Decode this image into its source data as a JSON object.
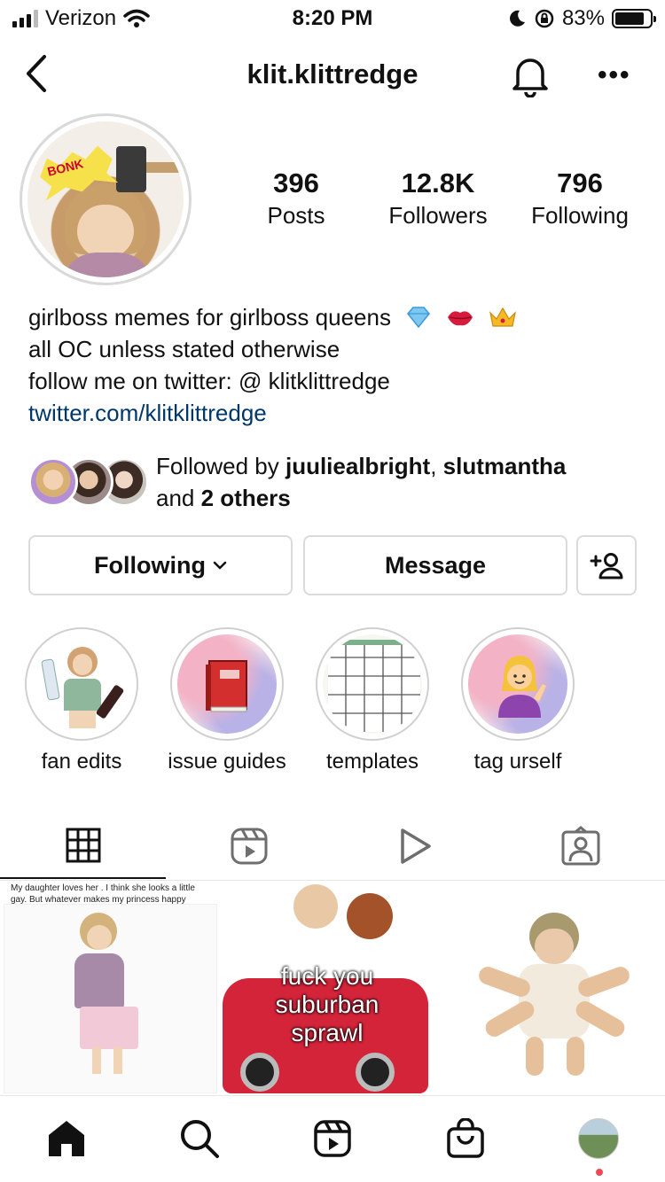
{
  "status_bar": {
    "carrier": "Verizon",
    "time": "8:20 PM",
    "battery": "83%",
    "battery_level": 0.83
  },
  "header": {
    "username": "klit.klittredge"
  },
  "profile": {
    "stats": [
      {
        "value": "396",
        "label": "Posts"
      },
      {
        "value": "12.8K",
        "label": "Followers"
      },
      {
        "value": "796",
        "label": "Following"
      }
    ],
    "avatar_text": "BONK",
    "bio": {
      "line1": "girlboss memes for girlboss queens",
      "line2": "all OC unless stated otherwise",
      "line3": "follow me on twitter: @ klitklittredge",
      "link": "twitter.com/klitklittredge"
    },
    "followed_by": {
      "prefix": "Followed by ",
      "user1": "juulieal​bright",
      "sep": ", ",
      "user2": "slutmantha",
      "and": "and ",
      "others": "2 others"
    }
  },
  "actions": {
    "following": "Following",
    "message": "Message"
  },
  "highlights": [
    {
      "label": "fan edits"
    },
    {
      "label": "issue guides"
    },
    {
      "label": "templates"
    },
    {
      "label": "tag urself"
    }
  ],
  "posts": [
    {
      "caption": "My daughter loves her . I think she looks a little gay. But whatever makes my princess happy"
    },
    {
      "caption": "fuck you suburban sprawl"
    },
    {
      "caption": ""
    }
  ],
  "icons": {
    "back": "chevron-left-icon",
    "bell": "bell-icon",
    "more": "more-icon",
    "grid": "grid-icon",
    "reels": "reels-icon",
    "play": "play-icon",
    "tagged": "tagged-icon",
    "home": "home-icon",
    "search": "search-icon",
    "shop": "shop-icon"
  },
  "colors": {
    "link": "#00376b",
    "border": "#dbdbdb",
    "notification_dot": "#ed4956"
  }
}
